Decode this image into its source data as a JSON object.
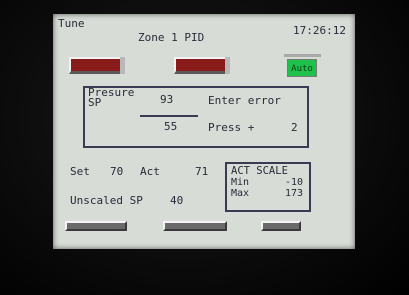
{
  "screen": {
    "mode_label": "Tune",
    "title": "Zone 1 PID",
    "clock": "17:26:12"
  },
  "auto_button": {
    "label": "Auto",
    "color": "#1ec24a"
  },
  "pid_panel": {
    "pv_label": "Presure",
    "sp_label": "SP",
    "pv_value": "93",
    "sp_value": "55",
    "enter_error_label": "Enter error",
    "press_label": "Press +",
    "press_value": "2"
  },
  "setpoint": {
    "set_label": "Set",
    "set_value": "70",
    "act_label": "Act",
    "act_value": "71",
    "unscaled_label": "Unscaled SP",
    "unscaled_value": "40"
  },
  "act_scale": {
    "title": "ACT SCALE",
    "min_label": "Min",
    "min_value": "-10",
    "max_label": "Max",
    "max_value": "173"
  },
  "colors": {
    "screen_bg": "#d8dcd6",
    "alarm_red": "#8a1b1b",
    "text": "#2a2a38"
  }
}
